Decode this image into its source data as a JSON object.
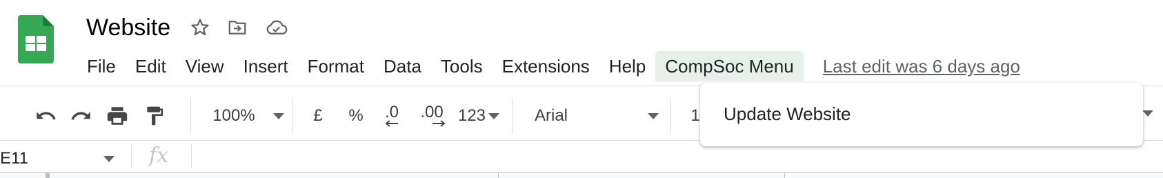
{
  "doc": {
    "title": "Website",
    "icons": [
      "sheets-logo",
      "star-icon",
      "move-to-folder-icon",
      "cloud-saved-icon"
    ]
  },
  "menubar": {
    "items": [
      "File",
      "Edit",
      "View",
      "Insert",
      "Format",
      "Data",
      "Tools",
      "Extensions",
      "Help",
      "CompSoc Menu"
    ],
    "active_item": "CompSoc Menu",
    "last_edit": "Last edit was 6 days ago"
  },
  "toolbar": {
    "zoom": "100%",
    "currency": "£",
    "percent": "%",
    "decrease_decimal": ".0",
    "increase_decimal": ".00",
    "number_format": "123",
    "font": "Arial",
    "font_size": "1",
    "icons": [
      "undo-icon",
      "redo-icon",
      "print-icon",
      "paint-format-icon"
    ]
  },
  "formula_bar": {
    "cell_ref": "E11",
    "fx": "fx",
    "value": ""
  },
  "dropdown": {
    "items": [
      "Update Website"
    ]
  },
  "colors": {
    "sheets_green": "#0f9d58",
    "active_menu_bg": "#e6f1e9",
    "divider": "#dadce0"
  }
}
